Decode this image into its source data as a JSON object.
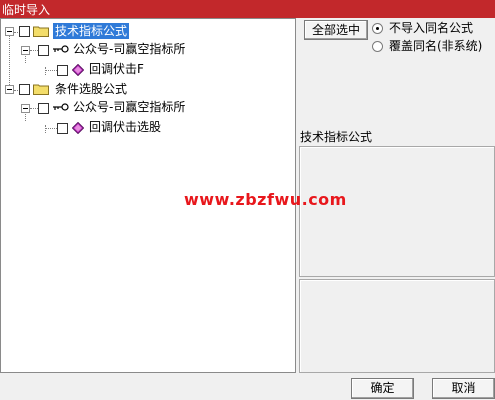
{
  "window": {
    "title": "临时导入"
  },
  "tree": {
    "nodes": [
      {
        "label": "技术指标公式",
        "selected": true
      },
      {
        "label": "公众号-司赢空指标所"
      },
      {
        "label": "回调伏击F"
      },
      {
        "label": "条件选股公式"
      },
      {
        "label": "公众号-司赢空指标所"
      },
      {
        "label": "回调伏击选股"
      }
    ]
  },
  "options": {
    "select_all_label": "全部选中",
    "radio_skip_label": "不导入同名公式",
    "radio_overwrite_label": "覆盖同名(非系统)",
    "selected_radio": "skip"
  },
  "info": {
    "category_label": "技术指标公式"
  },
  "watermark": "www.zbzfwu.com",
  "footer": {
    "ok_label": "确定",
    "cancel_label": "取消"
  },
  "colors": {
    "titlebar": "#c2282b",
    "selection": "#2f7ad8",
    "watermark": "#e8171c"
  }
}
